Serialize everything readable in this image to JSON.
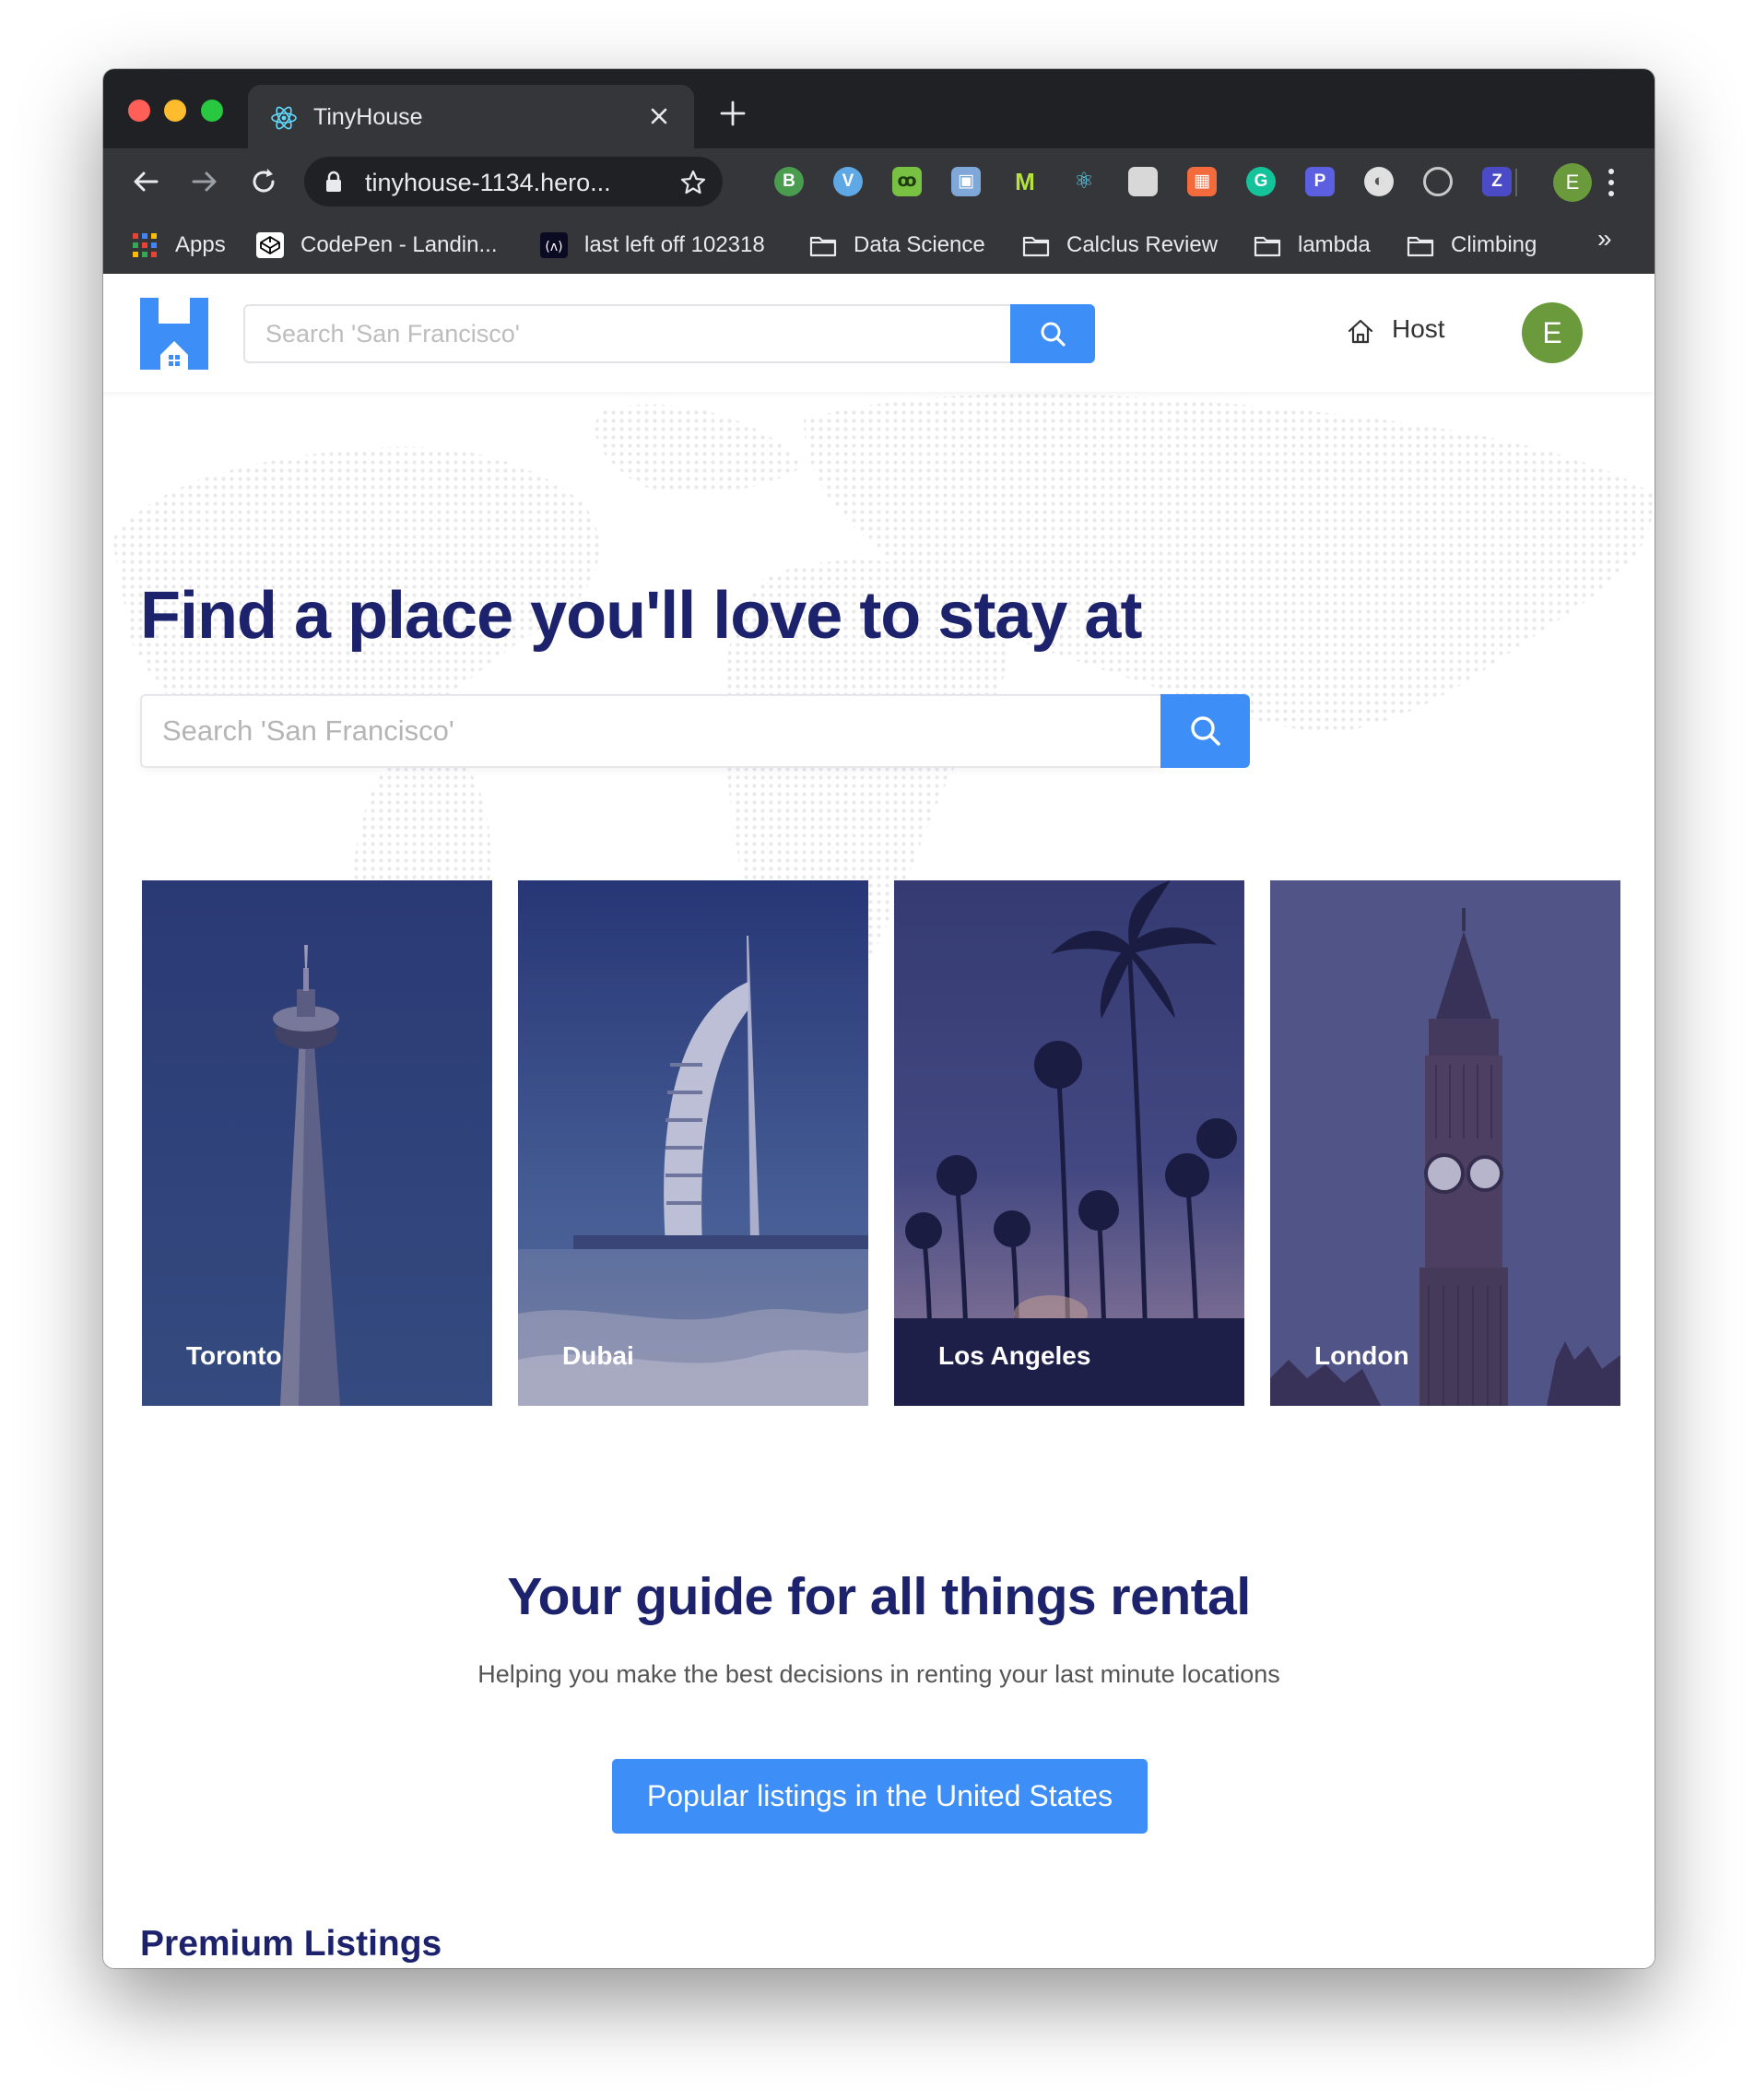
{
  "browser": {
    "tab": {
      "title": "TinyHouse",
      "icon": "react-atom-icon"
    },
    "url": "tinyhouse-1134.hero...",
    "profile_initial": "E",
    "bookmarks": [
      {
        "label": "Apps",
        "icon": "apps-grid-icon"
      },
      {
        "label": "CodePen - Landin...",
        "icon": "codepen-icon"
      },
      {
        "label": "last left off 102318",
        "icon": "freecodecamp-icon"
      },
      {
        "label": "Data Science",
        "icon": "folder-icon"
      },
      {
        "label": "Calclus Review",
        "icon": "folder-icon"
      },
      {
        "label": "lambda",
        "icon": "folder-icon"
      },
      {
        "label": "Climbing",
        "icon": "folder-icon"
      }
    ],
    "bookmarks_overflow": "»"
  },
  "header": {
    "search_placeholder": "Search 'San Francisco'",
    "host_label": "Host",
    "avatar_initial": "E"
  },
  "hero": {
    "title": "Find a place you'll love to stay at",
    "search_placeholder": "Search 'San Francisco'",
    "cities": [
      {
        "name": "Toronto"
      },
      {
        "name": "Dubai"
      },
      {
        "name": "Los Angeles"
      },
      {
        "name": "London"
      }
    ]
  },
  "guide": {
    "title": "Your guide for all things rental",
    "subtitle": "Helping you make the best decisions in renting your last minute locations",
    "button_label": "Popular listings in the United States"
  },
  "premium": {
    "title": "Premium Listings"
  },
  "colors": {
    "primary_blue": "#3e8ef7",
    "heading_navy": "#1d226c",
    "avatar_green": "#6a9a3b"
  }
}
